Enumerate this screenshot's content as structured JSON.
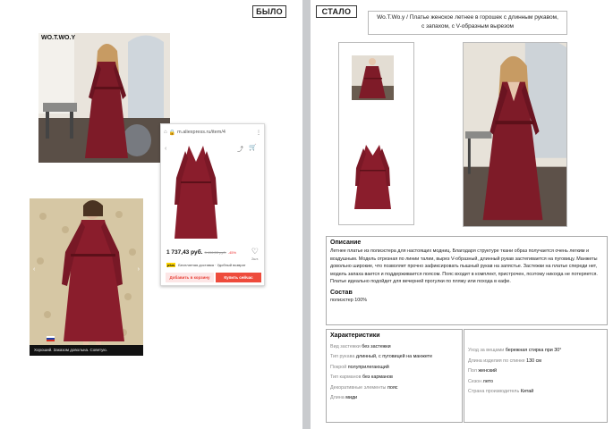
{
  "left": {
    "tag": "БЫЛО",
    "watermark": "WO.T.WO.Y",
    "product_card": {
      "url": "m.aliexpress.ru/item/4",
      "price": "1 737,43 руб.",
      "old_price": "3 496,53 руб.",
      "discount": "-45%",
      "plus_label": "plus",
      "delivery": "Бесплатная доставка · Удобный возврат",
      "buy_count": "2шт.",
      "add_to_cart": "Добавить в корзину",
      "buy_now": "Купить сейчас"
    },
    "review_caption": "Хороший. Заказом довольна. Советую."
  },
  "right": {
    "tag": "СТАЛО",
    "title_line1": "Wo.T.Wo.y  / Платье женское летнее в горошек с длинным рукавом,",
    "title_line2": "с запахом, с V-образным вырезом",
    "description_heading": "Описание",
    "description": "Летнее платье из полиэстера для настоящих модниц. Благодаря структуре ткани образ получается очень легким и воздушным. Модель отрезная по линии талии, вырез V-образный, длинный рукав застегивается на пуговицу. Манжеты довольно широкие, что позволяет прочно зафиксировать пышный рукав на запястье. Застежки на платье спереди нет, модель запаха вается и поддерживается поясом. Пояс входит в комплект, пристрочен, поэтому никогда не потеряется. Платье идеально подойдет для вечерней прогулки по пляжу или похода в кафе.",
    "composition_heading": "Состав",
    "composition": "полиэстер 100%",
    "characteristics_heading": "Характеристики",
    "characteristics_left": [
      {
        "k": "Вид застежки",
        "v": "без застежки"
      },
      {
        "k": "Тип рукава",
        "v": "длинный, с пуговицей на манжете"
      },
      {
        "k": "Покрой",
        "v": "полуприлегающий"
      },
      {
        "k": "Тип карманов",
        "v": "без карманов"
      },
      {
        "k": "Декоративные элементы",
        "v": "пояс"
      },
      {
        "k": "Длина",
        "v": "миди"
      }
    ],
    "characteristics_right": [
      {
        "k": "Уход за вещами",
        "v": "бережная стирка при 30°"
      },
      {
        "k": "Длина изделия по спинке",
        "v": "130 см"
      },
      {
        "k": "Пол",
        "v": "женский"
      },
      {
        "k": "Сезон",
        "v": "лето"
      },
      {
        "k": "Страна производитель",
        "v": "Китай"
      }
    ]
  },
  "colors": {
    "dress": "#7e1b28",
    "dress_dark": "#5c1019",
    "divider": "#c9cbce",
    "buy_button": "#ee4b3c"
  }
}
